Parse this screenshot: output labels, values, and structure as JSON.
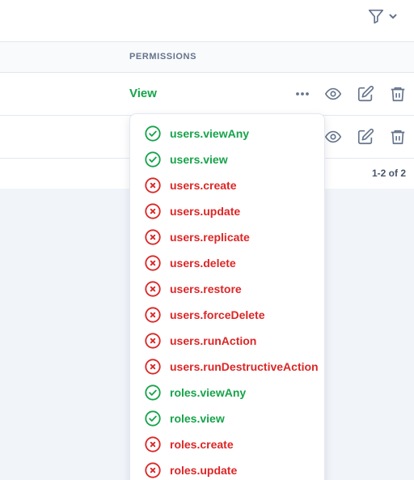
{
  "colors": {
    "granted": "#16a34a",
    "denied": "#dc2626",
    "icon_muted": "#64748b"
  },
  "toolbar": {
    "filter_icon": "filter-icon",
    "chevron_icon": "chevron-down-icon"
  },
  "table": {
    "header": {
      "permissions": "PERMISSIONS"
    },
    "rows": [
      {
        "permissions_link": "View"
      },
      {
        "permissions_link": ""
      }
    ],
    "pagination": "1-2 of 2"
  },
  "permissions_dropdown": {
    "items": [
      {
        "label": "users.viewAny",
        "granted": true
      },
      {
        "label": "users.view",
        "granted": true
      },
      {
        "label": "users.create",
        "granted": false
      },
      {
        "label": "users.update",
        "granted": false
      },
      {
        "label": "users.replicate",
        "granted": false
      },
      {
        "label": "users.delete",
        "granted": false
      },
      {
        "label": "users.restore",
        "granted": false
      },
      {
        "label": "users.forceDelete",
        "granted": false
      },
      {
        "label": "users.runAction",
        "granted": false
      },
      {
        "label": "users.runDestructiveAction",
        "granted": false
      },
      {
        "label": "roles.viewAny",
        "granted": true
      },
      {
        "label": "roles.view",
        "granted": true
      },
      {
        "label": "roles.create",
        "granted": false
      },
      {
        "label": "roles.update",
        "granted": false
      }
    ]
  }
}
